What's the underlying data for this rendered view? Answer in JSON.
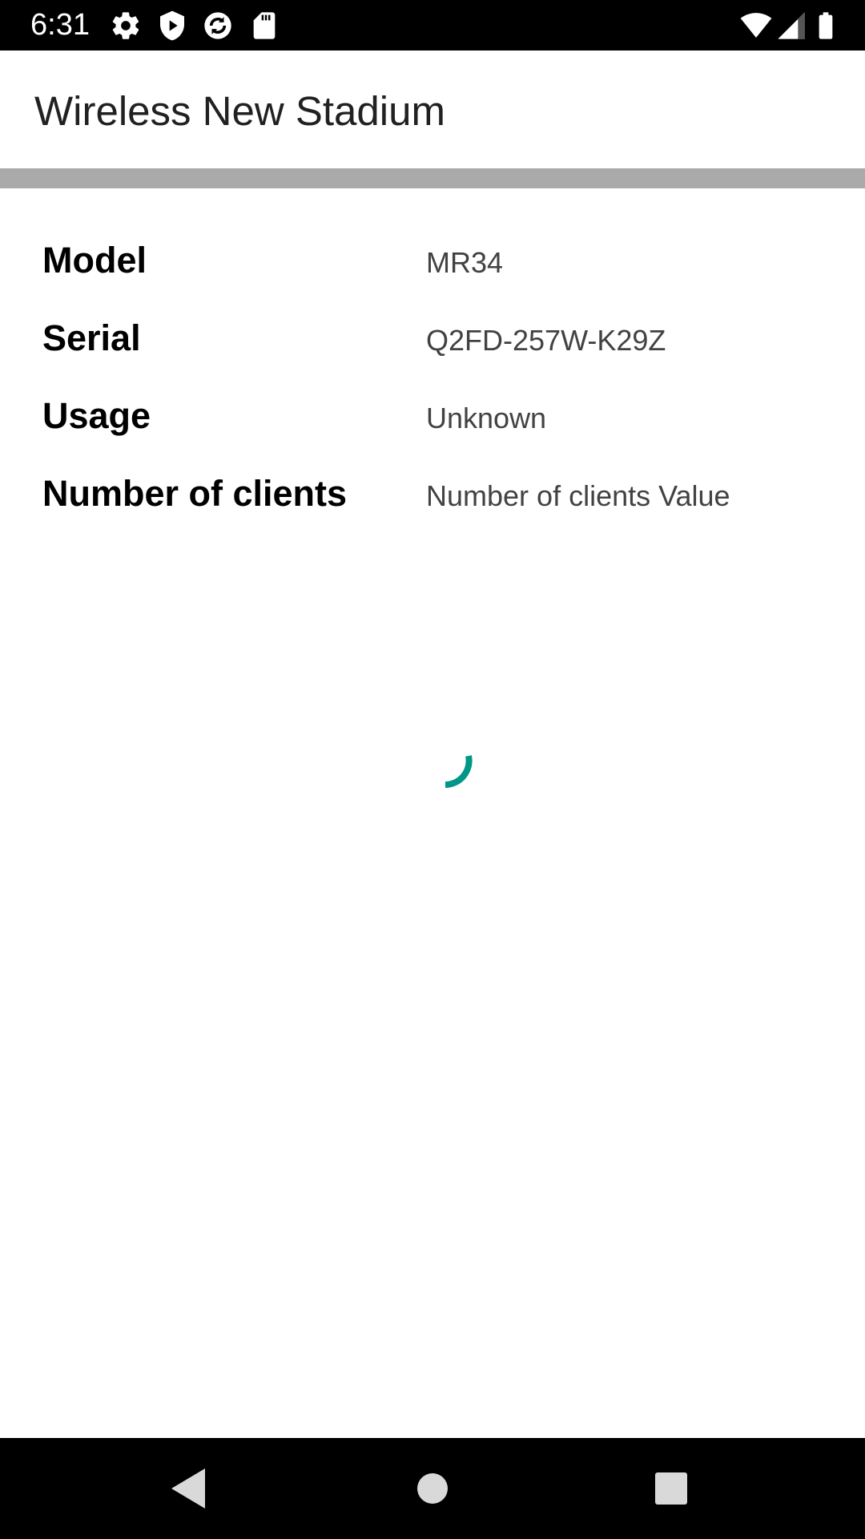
{
  "status_bar": {
    "time": "6:31",
    "left_icons": [
      "gear-icon",
      "shield-play-icon",
      "sync-icon",
      "sd-card-icon"
    ],
    "right_icons": [
      "wifi-icon",
      "cell-signal-icon",
      "battery-icon"
    ]
  },
  "app_bar": {
    "title": "Wireless New Stadium"
  },
  "details": [
    {
      "label": "Model",
      "value": "MR34"
    },
    {
      "label": "Serial",
      "value": "Q2FD-257W-K29Z"
    },
    {
      "label": "Usage",
      "value": "Unknown"
    },
    {
      "label": "Number of clients",
      "value": "Number of clients Value"
    }
  ],
  "loading": {
    "indicator": "progress-spinner",
    "color": "#009688"
  },
  "nav_bar": {
    "buttons": [
      "back-icon",
      "home-icon",
      "recents-icon"
    ]
  }
}
